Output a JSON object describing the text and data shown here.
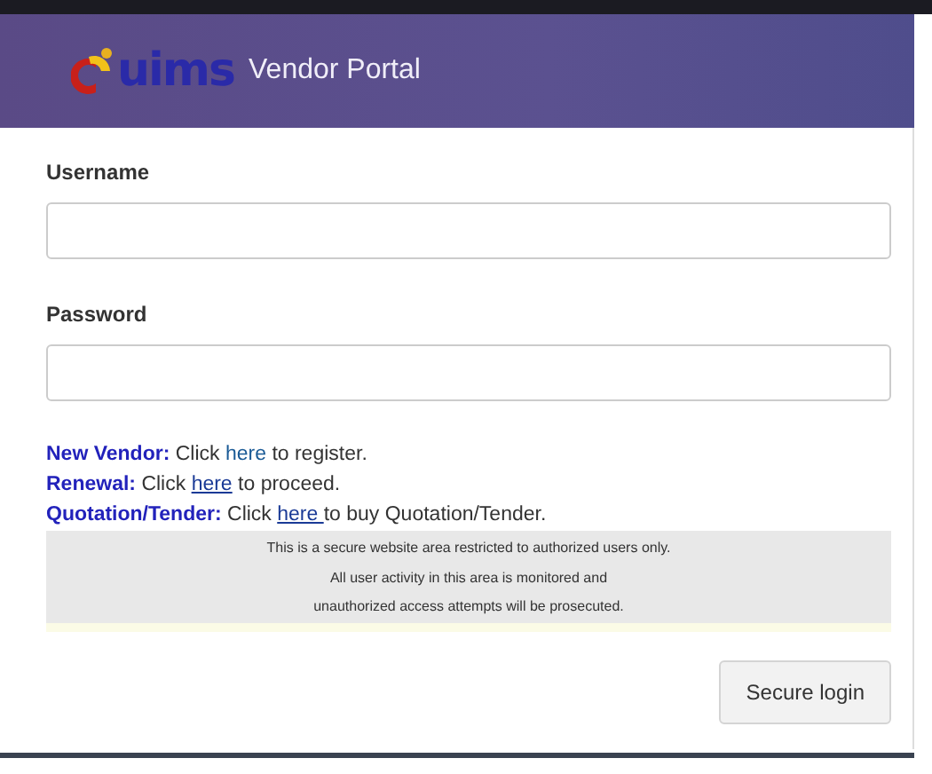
{
  "header": {
    "logo_text": "uims",
    "title": "Vendor Portal"
  },
  "fields": [
    {
      "label": "Username"
    },
    {
      "label": "Password"
    }
  ],
  "links": [
    {
      "text": "**New Vendor:** Click ",
      "link": "here",
      "underlined": false,
      "after": " to register."
    },
    {
      "text": "**Renewal:** Click ",
      "link": "here",
      "underlined": true,
      "after": " to proceed."
    },
    {
      "text": "**Quotation/Tender:** Click ",
      "link": "here ",
      "underlined": true,
      "after": "to buy Quotation/Tender."
    }
  ],
  "notice": [
    "This is a secure website area restricted to authorized users only.",
    "All user activity in this area is monitored and",
    "unauthorized access attempts will be prosecuted."
  ],
  "button": "Secure login"
}
